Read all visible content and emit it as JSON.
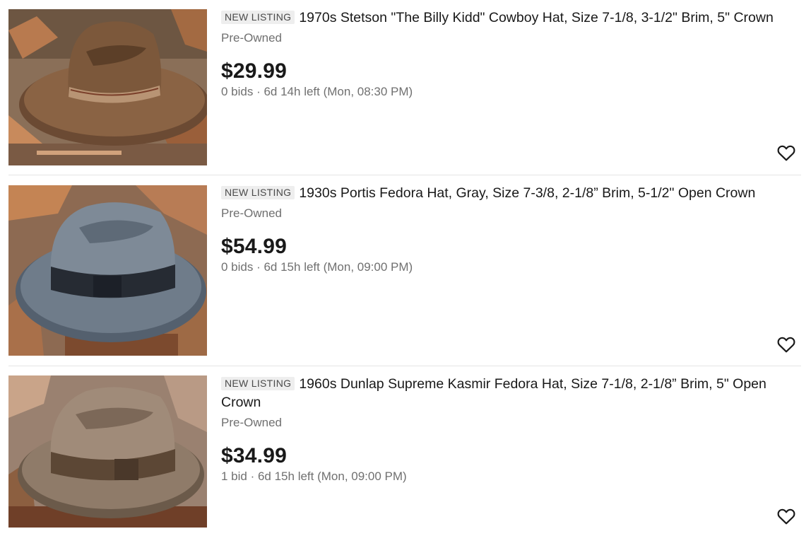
{
  "listings": [
    {
      "badge": "NEW LISTING",
      "title": "1970s Stetson \"The Billy Kidd\" Cowboy Hat, Size 7-1/8, 3-1/2\" Brim, 5\" Crown",
      "condition": "Pre-Owned",
      "price": "$29.99",
      "meta": "0 bids · 6d 14h left (Mon, 08:30 PM)",
      "image_icon": "brown-cowboy-hat-photo",
      "watch_icon": "heart-outline-icon"
    },
    {
      "badge": "NEW LISTING",
      "title": "1930s Portis Fedora Hat, Gray, Size 7-3/8, 2-1/8” Brim, 5-1/2\" Open Crown",
      "condition": "Pre-Owned",
      "price": "$54.99",
      "meta": "0 bids · 6d 15h left (Mon, 09:00 PM)",
      "image_icon": "gray-fedora-hat-photo",
      "watch_icon": "heart-outline-icon"
    },
    {
      "badge": "NEW LISTING",
      "title": "1960s Dunlap Supreme Kasmir Fedora Hat, Size 7-1/8, 2-1/8” Brim, 5\" Open Crown",
      "condition": "Pre-Owned",
      "price": "$34.99",
      "meta": "1 bid · 6d 15h left (Mon, 09:00 PM)",
      "image_icon": "tan-fedora-hat-photo",
      "watch_icon": "heart-outline-icon"
    }
  ],
  "colors": {
    "text_primary": "#191919",
    "text_secondary": "#707070",
    "badge_bg": "#eeeeee",
    "divider": "#e5e5e5"
  }
}
